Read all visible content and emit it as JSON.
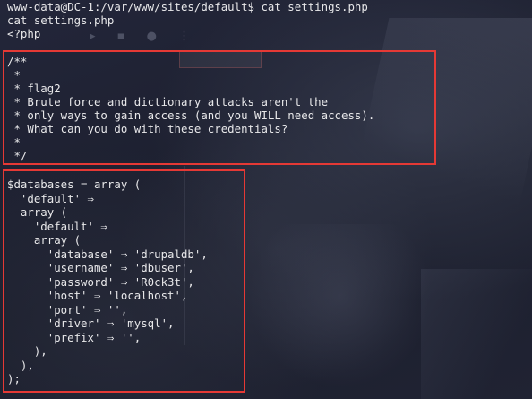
{
  "terminal": {
    "prompt_line": "www-data@DC-1:/var/www/sites/default$ cat settings.php",
    "echo_command": "cat settings.php",
    "php_open": "<?php"
  },
  "comment_block": {
    "lines": [
      "/**",
      " *",
      " * flag2",
      " * Brute force and dictionary attacks aren't the",
      " * only ways to gain access (and you WILL need access).",
      " * What can you do with these credentials?",
      " *",
      " */"
    ]
  },
  "database_block": {
    "lines": [
      "$databases = array (",
      "  'default' ⇒",
      "  array (",
      "    'default' ⇒",
      "    array (",
      "      'database' ⇒ 'drupaldb',",
      "      'username' ⇒ 'dbuser',",
      "      'password' ⇒ 'R0ck3t',",
      "      'host' ⇒ 'localhost',",
      "      'port' ⇒ '',",
      "      'driver' ⇒ 'mysql',",
      "      'prefix' ⇒ '',",
      "    ),",
      "  ),",
      ");"
    ]
  },
  "colors": {
    "text": "#e8e8ea",
    "highlight_border": "#e53935",
    "background": "#1e2130"
  }
}
